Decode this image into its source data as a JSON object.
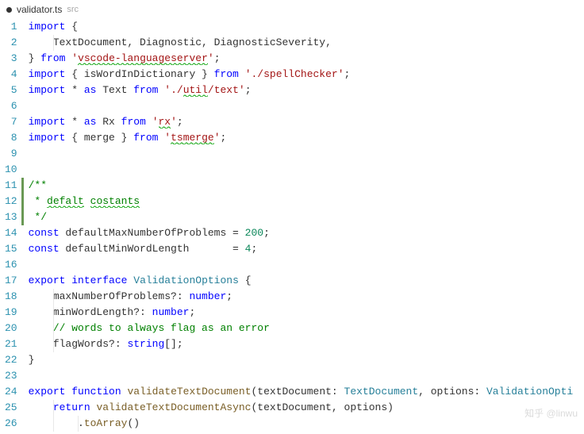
{
  "tab": {
    "modified": true,
    "name": "validator.ts",
    "path": "src"
  },
  "lines": [
    {
      "n": 1,
      "indent": 0,
      "tokens": [
        [
          "kw",
          "import"
        ],
        [
          "",
          " {"
        ]
      ]
    },
    {
      "n": 2,
      "indent": 1,
      "tokens": [
        [
          "",
          "    TextDocument, Diagnostic, DiagnosticSeverity,"
        ]
      ]
    },
    {
      "n": 3,
      "indent": 0,
      "tokens": [
        [
          "",
          "} "
        ],
        [
          "kw",
          "from"
        ],
        [
          "",
          " "
        ],
        [
          "str",
          "'"
        ],
        [
          "str squiggle",
          "vscode-languageserver"
        ],
        [
          "str",
          "'"
        ],
        [
          "",
          ";"
        ]
      ]
    },
    {
      "n": 4,
      "indent": 0,
      "tokens": [
        [
          "kw",
          "import"
        ],
        [
          "",
          " { isWordInDictionary } "
        ],
        [
          "kw",
          "from"
        ],
        [
          "",
          " "
        ],
        [
          "str",
          "'./spellChecker'"
        ],
        [
          "",
          ";"
        ]
      ]
    },
    {
      "n": 5,
      "indent": 0,
      "tokens": [
        [
          "kw",
          "import"
        ],
        [
          "",
          " * "
        ],
        [
          "kw",
          "as"
        ],
        [
          "",
          " Text "
        ],
        [
          "kw",
          "from"
        ],
        [
          "",
          " "
        ],
        [
          "str",
          "'./"
        ],
        [
          "str squiggle",
          "util"
        ],
        [
          "str",
          "/text'"
        ],
        [
          "",
          ";"
        ]
      ]
    },
    {
      "n": 6,
      "indent": 0,
      "tokens": []
    },
    {
      "n": 7,
      "indent": 0,
      "tokens": [
        [
          "kw",
          "import"
        ],
        [
          "",
          " * "
        ],
        [
          "kw",
          "as"
        ],
        [
          "",
          " Rx "
        ],
        [
          "kw",
          "from"
        ],
        [
          "",
          " "
        ],
        [
          "str",
          "'"
        ],
        [
          "str squiggle",
          "rx"
        ],
        [
          "str",
          "'"
        ],
        [
          "",
          ";"
        ]
      ]
    },
    {
      "n": 8,
      "indent": 0,
      "tokens": [
        [
          "kw",
          "import"
        ],
        [
          "",
          " { merge } "
        ],
        [
          "kw",
          "from"
        ],
        [
          "",
          " "
        ],
        [
          "str",
          "'"
        ],
        [
          "str squiggle",
          "tsmerge"
        ],
        [
          "str",
          "'"
        ],
        [
          "",
          ";"
        ]
      ]
    },
    {
      "n": 9,
      "indent": 0,
      "tokens": []
    },
    {
      "n": 10,
      "indent": 0,
      "tokens": []
    },
    {
      "n": 11,
      "indent": 0,
      "docbar": true,
      "tokens": [
        [
          "comment",
          "/**"
        ]
      ]
    },
    {
      "n": 12,
      "indent": 0,
      "docbar": true,
      "tokens": [
        [
          "comment",
          " * "
        ],
        [
          "comment squiggle",
          "defalt"
        ],
        [
          "comment",
          " "
        ],
        [
          "comment squiggle",
          "costants"
        ]
      ]
    },
    {
      "n": 13,
      "indent": 0,
      "docbar": true,
      "tokens": [
        [
          "comment",
          " */"
        ]
      ]
    },
    {
      "n": 14,
      "indent": 0,
      "tokens": [
        [
          "kw",
          "const"
        ],
        [
          "",
          " defaultMaxNumberOfProblems = "
        ],
        [
          "num",
          "200"
        ],
        [
          "",
          ";"
        ]
      ]
    },
    {
      "n": 15,
      "indent": 0,
      "tokens": [
        [
          "kw",
          "const"
        ],
        [
          "",
          " defaultMinWordLength       = "
        ],
        [
          "num",
          "4"
        ],
        [
          "",
          ";"
        ]
      ]
    },
    {
      "n": 16,
      "indent": 0,
      "tokens": []
    },
    {
      "n": 17,
      "indent": 0,
      "tokens": [
        [
          "kw",
          "export"
        ],
        [
          "",
          " "
        ],
        [
          "kw",
          "interface"
        ],
        [
          "",
          " "
        ],
        [
          "type",
          "ValidationOptions"
        ],
        [
          "",
          " {"
        ]
      ]
    },
    {
      "n": 18,
      "indent": 1,
      "tokens": [
        [
          "",
          "    maxNumberOfProblems?: "
        ],
        [
          "kw",
          "number"
        ],
        [
          "",
          ";"
        ]
      ]
    },
    {
      "n": 19,
      "indent": 1,
      "tokens": [
        [
          "",
          "    minWordLength?: "
        ],
        [
          "kw",
          "number"
        ],
        [
          "",
          ";"
        ]
      ]
    },
    {
      "n": 20,
      "indent": 1,
      "tokens": [
        [
          "",
          "    "
        ],
        [
          "comment",
          "// words to always flag as an error"
        ]
      ]
    },
    {
      "n": 21,
      "indent": 1,
      "tokens": [
        [
          "",
          "    flagWords?: "
        ],
        [
          "kw",
          "string"
        ],
        [
          "",
          "[];"
        ]
      ]
    },
    {
      "n": 22,
      "indent": 0,
      "tokens": [
        [
          "",
          "}"
        ]
      ]
    },
    {
      "n": 23,
      "indent": 0,
      "tokens": []
    },
    {
      "n": 24,
      "indent": 0,
      "tokens": [
        [
          "kw",
          "export"
        ],
        [
          "",
          " "
        ],
        [
          "kw",
          "function"
        ],
        [
          "",
          " "
        ],
        [
          "fn",
          "validateTextDocument"
        ],
        [
          "",
          "(textDocument: "
        ],
        [
          "type",
          "TextDocument"
        ],
        [
          "",
          ", options: "
        ],
        [
          "type",
          "ValidationOpti"
        ]
      ]
    },
    {
      "n": 25,
      "indent": 1,
      "tokens": [
        [
          "",
          "    "
        ],
        [
          "kw",
          "return"
        ],
        [
          "",
          " "
        ],
        [
          "fn",
          "validateTextDocumentAsync"
        ],
        [
          "",
          "(textDocument, options)"
        ]
      ]
    },
    {
      "n": 26,
      "indent": 2,
      "tokens": [
        [
          "",
          "        ."
        ],
        [
          "fn",
          "toArray"
        ],
        [
          "",
          "()"
        ]
      ]
    }
  ],
  "watermark": "知乎 @linwu"
}
